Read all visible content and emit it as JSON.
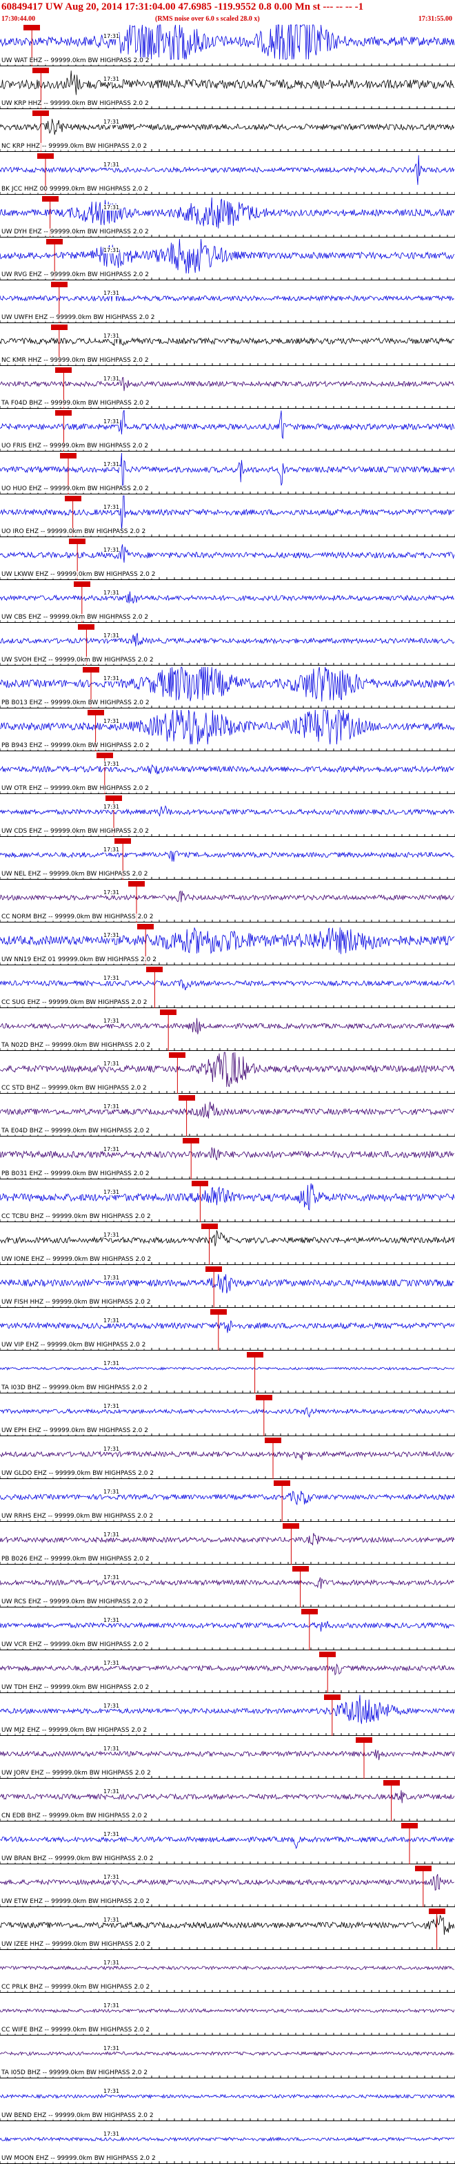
{
  "header": {
    "title": "60849417 UW Aug 20, 2014 17:31:04.00   47.6985 -119.9552  0.8 0.00 Mn st --- -- -- -1",
    "start_time": "17:30:44.00",
    "note": "(RMS noise over 6.0 s scaled 28.0 x)",
    "end_time": "17:31:55.00"
  },
  "tick_label": "17:31",
  "colors": {
    "header_red": "#d40000",
    "blue": "#0000e0",
    "purple": "#3d0070",
    "black": "#000000",
    "pick_red": "#d40000"
  },
  "traces": [
    {
      "label": "UW WAT EHZ -- 99999.0km BW  HIGHPASS  2.0  2",
      "color": "blue",
      "amp": 0.55,
      "pick": 0.07,
      "bursts": [
        [
          0.35,
          0.08,
          5.5
        ],
        [
          0.65,
          0.06,
          6.5
        ]
      ]
    },
    {
      "label": "UW KRP HHZ -- 99999.0km BW  HIGHPASS  2.0  2",
      "color": "black",
      "amp": 0.55,
      "pick": 0.09,
      "bursts": [
        [
          0.16,
          0.01,
          3.0
        ]
      ]
    },
    {
      "label": "NC KRP HHZ -- 99999.0km BW  HIGHPASS  2.0  2",
      "color": "black",
      "amp": 0.35,
      "pick": 0.09,
      "bursts": [
        [
          0.12,
          0.02,
          2.0
        ]
      ]
    },
    {
      "label": "BK JCC HHZ 00 99999.0km BW  HIGHPASS  2.0  2",
      "color": "blue",
      "amp": 0.3,
      "pick": 0.1,
      "bursts": [
        [
          0.92,
          0.005,
          6.0
        ]
      ]
    },
    {
      "label": "UW DYH EHZ -- 99999.0km BW  HIGHPASS  2.0  2",
      "color": "blue",
      "amp": 0.4,
      "pick": 0.11,
      "bursts": [
        [
          0.22,
          0.05,
          3.0
        ],
        [
          0.48,
          0.07,
          4.0
        ]
      ]
    },
    {
      "label": "UW RVG EHZ -- 99999.0km BW  HIGHPASS  2.0  2",
      "color": "blue",
      "amp": 0.4,
      "pick": 0.12,
      "bursts": [
        [
          0.25,
          0.04,
          3.0
        ],
        [
          0.42,
          0.06,
          5.0
        ]
      ]
    },
    {
      "label": "UW UWFH EHZ -- 99999.0km BW  HIGHPASS  2.0  2",
      "color": "blue",
      "amp": 0.3,
      "pick": 0.13,
      "bursts": [
        [
          0.25,
          0.01,
          2.0
        ]
      ]
    },
    {
      "label": "NC KMR HHZ -- 99999.0km BW  HIGHPASS  2.0  2",
      "color": "black",
      "amp": 0.35,
      "pick": 0.13,
      "bursts": [
        [
          0.26,
          0.01,
          2.0
        ]
      ]
    },
    {
      "label": "TA F04D BHZ -- 99999.0km BW  HIGHPASS  2.0  2",
      "color": "purple",
      "amp": 0.3,
      "pick": 0.14,
      "bursts": [
        [
          0.27,
          0.01,
          2.0
        ]
      ]
    },
    {
      "label": "UO FRIS EHZ -- 99999.0km BW  HIGHPASS  2.0  2",
      "color": "blue",
      "amp": 0.35,
      "pick": 0.14,
      "bursts": [
        [
          0.27,
          0.005,
          9.0
        ],
        [
          0.62,
          0.004,
          7.0
        ]
      ]
    },
    {
      "label": "UO HUO EHZ -- 99999.0km BW  HIGHPASS  2.0  2",
      "color": "blue",
      "amp": 0.35,
      "pick": 0.15,
      "bursts": [
        [
          0.27,
          0.005,
          9.0
        ],
        [
          0.53,
          0.004,
          5.0
        ],
        [
          0.62,
          0.004,
          6.0
        ]
      ]
    },
    {
      "label": "UO IRO EHZ -- 99999.0km BW  HIGHPASS  2.0  2",
      "color": "blue",
      "amp": 0.35,
      "pick": 0.16,
      "bursts": [
        [
          0.27,
          0.005,
          8.0
        ]
      ]
    },
    {
      "label": "UW LKWW EHZ -- 99999.0km BW  HIGHPASS  2.0  2",
      "color": "blue",
      "amp": 0.35,
      "pick": 0.17,
      "bursts": [
        [
          0.27,
          0.01,
          3.0
        ]
      ]
    },
    {
      "label": "UW CBS EHZ -- 99999.0km BW  HIGHPASS  2.0  2",
      "color": "blue",
      "amp": 0.3,
      "pick": 0.18,
      "bursts": [
        [
          0.29,
          0.01,
          3.0
        ]
      ]
    },
    {
      "label": "UW SVOH EHZ -- 99999.0km BW  HIGHPASS  2.0  2",
      "color": "blue",
      "amp": 0.3,
      "pick": 0.19,
      "bursts": [
        [
          0.3,
          0.01,
          2.5
        ]
      ]
    },
    {
      "label": "PB B013 EHZ -- 99999.0km BW  HIGHPASS  2.0  2",
      "color": "blue",
      "amp": 0.45,
      "pick": 0.2,
      "bursts": [
        [
          0.42,
          0.08,
          5.0
        ],
        [
          0.72,
          0.06,
          5.0
        ]
      ]
    },
    {
      "label": "PB B943 EHZ -- 99999.0km BW  HIGHPASS  2.0  2",
      "color": "blue",
      "amp": 0.45,
      "pick": 0.21,
      "bursts": [
        [
          0.42,
          0.08,
          5.0
        ],
        [
          0.72,
          0.06,
          5.0
        ]
      ]
    },
    {
      "label": "UW OTR EHZ -- 99999.0km BW  HIGHPASS  2.0  2",
      "color": "blue",
      "amp": 0.35,
      "pick": 0.23,
      "bursts": [
        [
          0.34,
          0.01,
          2.0
        ]
      ]
    },
    {
      "label": "UW CDS EHZ -- 99999.0km BW  HIGHPASS  2.0  2",
      "color": "blue",
      "amp": 0.3,
      "pick": 0.25,
      "bursts": [
        [
          0.36,
          0.01,
          2.0
        ]
      ]
    },
    {
      "label": "UW NEL EHZ -- 99999.0km BW  HIGHPASS  2.0  2",
      "color": "blue",
      "amp": 0.3,
      "pick": 0.27,
      "bursts": [
        [
          0.38,
          0.01,
          2.0
        ]
      ]
    },
    {
      "label": "CC NORM BHZ -- 99999.0km BW  HIGHPASS  2.0  2",
      "color": "purple",
      "amp": 0.3,
      "pick": 0.3,
      "bursts": [
        [
          0.4,
          0.01,
          2.0
        ]
      ]
    },
    {
      "label": "UW NN19 EHZ 01 99999.0km BW  HIGHPASS  2.0  2",
      "color": "blue",
      "amp": 0.55,
      "pick": 0.32,
      "bursts": [
        [
          0.45,
          0.1,
          2.0
        ],
        [
          0.75,
          0.08,
          2.0
        ]
      ]
    },
    {
      "label": "CC SUG EHZ -- 99999.0km BW  HIGHPASS  2.0  2",
      "color": "blue",
      "amp": 0.3,
      "pick": 0.34,
      "bursts": [
        [
          0.41,
          0.01,
          2.5
        ]
      ]
    },
    {
      "label": "TA N02D BHZ -- 99999.0km BW  HIGHPASS  2.0  2",
      "color": "purple",
      "amp": 0.3,
      "pick": 0.37,
      "bursts": [
        [
          0.43,
          0.01,
          3.0
        ]
      ]
    },
    {
      "label": "CC STD BHZ -- 99999.0km BW  HIGHPASS  2.0  2",
      "color": "purple",
      "amp": 0.4,
      "pick": 0.39,
      "bursts": [
        [
          0.5,
          0.04,
          6.0
        ]
      ]
    },
    {
      "label": "TA E04D BHZ -- 99999.0km BW  HIGHPASS  2.0  2",
      "color": "purple",
      "amp": 0.35,
      "pick": 0.41,
      "bursts": [
        [
          0.46,
          0.02,
          2.5
        ]
      ]
    },
    {
      "label": "PB B031 EHZ -- 99999.0km BW  HIGHPASS  2.0  2",
      "color": "purple",
      "amp": 0.4,
      "pick": 0.42,
      "bursts": [
        [
          0.47,
          0.01,
          2.5
        ]
      ]
    },
    {
      "label": "CC TCBU BHZ -- 99999.0km BW  HIGHPASS  2.0  2",
      "color": "blue",
      "amp": 0.45,
      "pick": 0.44,
      "bursts": [
        [
          0.47,
          0.03,
          2.5
        ],
        [
          0.68,
          0.02,
          3.0
        ]
      ]
    },
    {
      "label": "UW IONE EHZ -- 99999.0km BW  HIGHPASS  2.0  2",
      "color": "black",
      "amp": 0.35,
      "pick": 0.46,
      "bursts": [
        [
          0.48,
          0.01,
          3.0
        ]
      ]
    },
    {
      "label": "UW FISH HHZ -- 99999.0km BW  HIGHPASS  2.0  2",
      "color": "blue",
      "amp": 0.4,
      "pick": 0.47,
      "bursts": [
        [
          0.49,
          0.02,
          3.0
        ]
      ]
    },
    {
      "label": "UW VIP EHZ -- 99999.0km BW  HIGHPASS  2.0  2",
      "color": "blue",
      "amp": 0.35,
      "pick": 0.48,
      "bursts": [
        [
          0.5,
          0.01,
          2.0
        ]
      ]
    },
    {
      "label": "TA I03D BHZ -- 99999.0km BW  HIGHPASS  2.0  2",
      "color": "blue",
      "amp": 0.15,
      "pick": 0.56,
      "bursts": []
    },
    {
      "label": "UW EPH EHZ -- 99999.0km BW  HIGHPASS  2.0  2",
      "color": "blue",
      "amp": 0.25,
      "pick": 0.58,
      "bursts": [
        [
          0.68,
          0.01,
          2.0
        ]
      ]
    },
    {
      "label": "UW GLDO EHZ -- 99999.0km BW  HIGHPASS  2.0  2",
      "color": "purple",
      "amp": 0.3,
      "pick": 0.6,
      "bursts": [
        [
          0.66,
          0.01,
          2.0
        ]
      ]
    },
    {
      "label": "UW RRHS EHZ -- 99999.0km BW  HIGHPASS  2.0  2",
      "color": "blue",
      "amp": 0.3,
      "pick": 0.62,
      "bursts": [
        [
          0.66,
          0.02,
          2.5
        ]
      ]
    },
    {
      "label": "PB B026 EHZ -- 99999.0km BW  HIGHPASS  2.0  2",
      "color": "purple",
      "amp": 0.3,
      "pick": 0.64,
      "bursts": [
        [
          0.69,
          0.01,
          2.0
        ]
      ]
    },
    {
      "label": "UW RCS EHZ -- 99999.0km BW  HIGHPASS  2.0  2",
      "color": "purple",
      "amp": 0.3,
      "pick": 0.66,
      "bursts": [
        [
          0.7,
          0.01,
          2.0
        ]
      ]
    },
    {
      "label": "UW VCR EHZ -- 99999.0km BW  HIGHPASS  2.0  2",
      "color": "blue",
      "amp": 0.3,
      "pick": 0.68,
      "bursts": [
        [
          0.71,
          0.01,
          2.0
        ]
      ]
    },
    {
      "label": "UW TDH EHZ -- 99999.0km BW  HIGHPASS  2.0  2",
      "color": "purple",
      "amp": 0.3,
      "pick": 0.72,
      "bursts": [
        [
          0.74,
          0.01,
          2.0
        ]
      ]
    },
    {
      "label": "UW MJ2 EHZ -- 99999.0km BW  HIGHPASS  2.0  2",
      "color": "blue",
      "amp": 0.3,
      "pick": 0.73,
      "bursts": [
        [
          0.8,
          0.05,
          6.0
        ]
      ]
    },
    {
      "label": "UW JORV EHZ -- 99999.0km BW  HIGHPASS  2.0  2",
      "color": "purple",
      "amp": 0.3,
      "pick": 0.8,
      "bursts": [
        [
          0.83,
          0.01,
          2.0
        ]
      ]
    },
    {
      "label": "CN EDB BHZ -- 99999.0km BW  HIGHPASS  2.0  2",
      "color": "purple",
      "amp": 0.3,
      "pick": 0.86,
      "bursts": [
        [
          0.88,
          0.01,
          2.0
        ]
      ]
    },
    {
      "label": "UW BRAN BHZ -- 99999.0km BW  HIGHPASS  2.0  2",
      "color": "blue",
      "amp": 0.3,
      "pick": 0.9,
      "bursts": [
        [
          0.65,
          0.004,
          3.0
        ]
      ]
    },
    {
      "label": "UW ETW EHZ -- 99999.0km BW  HIGHPASS  2.0  2",
      "color": "purple",
      "amp": 0.3,
      "pick": 0.93,
      "bursts": [
        [
          0.96,
          0.01,
          2.5
        ]
      ]
    },
    {
      "label": "UW IZEE HHZ -- 99999.0km BW  HIGHPASS  2.0  2",
      "color": "black",
      "amp": 0.35,
      "pick": 0.96,
      "bursts": [
        [
          0.97,
          0.02,
          3.0
        ]
      ]
    },
    {
      "label": "CC PRLK BHZ -- 99999.0km BW  HIGHPASS  2.0  2",
      "color": "purple",
      "amp": 0.2,
      "pick": null,
      "bursts": []
    },
    {
      "label": "CC WIFE BHZ -- 99999.0km BW  HIGHPASS  2.0  2",
      "color": "purple",
      "amp": 0.2,
      "pick": null,
      "bursts": []
    },
    {
      "label": "TA I05D BHZ -- 99999.0km BW  HIGHPASS  2.0  2",
      "color": "purple",
      "amp": 0.2,
      "pick": null,
      "bursts": []
    },
    {
      "label": "UW BEND EHZ -- 99999.0km BW  HIGHPASS  2.0  2",
      "color": "blue",
      "amp": 0.2,
      "pick": null,
      "bursts": []
    },
    {
      "label": "UW MOON EHZ -- 99999.0km BW  HIGHPASS  2.0  2",
      "color": "blue",
      "amp": 0.2,
      "pick": null,
      "bursts": []
    }
  ]
}
